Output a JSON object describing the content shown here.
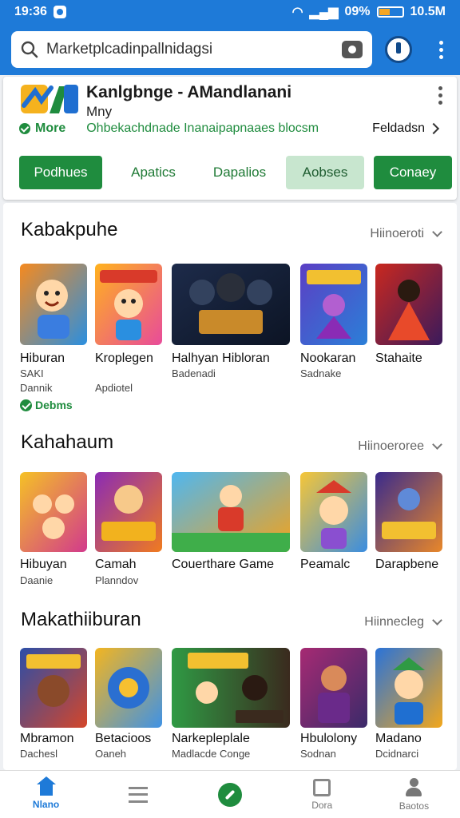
{
  "status_bar": {
    "time": "19:36",
    "battery_text": "09%",
    "clock_right": "10.5M",
    "battery_level": 0.45
  },
  "search": {
    "placeholder": "Marketplcadinpallnidagsi"
  },
  "app": {
    "title": "Kanlgbnge - AMandlanani",
    "subtitle": "Mny",
    "more_link": "More",
    "description": "Ohbekachdnade  Inanaipapnaaes blocsm",
    "description_link": "Feldadsn",
    "chips": [
      "Podhues",
      "Apatics",
      "Dapalios",
      "Aobses",
      "Conaey"
    ]
  },
  "sections": [
    {
      "title": "Kabakpuhe",
      "more": "Hiinoeroti",
      "items": [
        {
          "label": "Hiburan",
          "sub1": "SAKI",
          "sub2": "Dannik",
          "badge": "Debms",
          "colors": [
            "#f58a1f",
            "#2a8fe0"
          ]
        },
        {
          "label": "Kroplegen",
          "sub1": "Apdiotel",
          "colors": [
            "#ffb21e",
            "#e84b9a"
          ]
        },
        {
          "label": "Halhyan Hibloran",
          "sub1": "Badenadi",
          "colors": [
            "#1d2b4a",
            "#c98a2a"
          ]
        },
        {
          "label": "Nookaran",
          "sub1": "Sadnake",
          "colors": [
            "#5b3fc4",
            "#2b7fd8"
          ]
        },
        {
          "label": "Stahaite",
          "sub1": "",
          "colors": [
            "#c9281f",
            "#3a1a5c"
          ]
        }
      ]
    },
    {
      "title": "Kahahaum",
      "more": "Hiinoeroree",
      "items": [
        {
          "label": "Hibuyan",
          "sub1": "Daanie",
          "colors": [
            "#f5c126",
            "#d23a8c"
          ]
        },
        {
          "label": "Camah",
          "sub1": "Planndov",
          "colors": [
            "#8a2bb5",
            "#f07b1f"
          ]
        },
        {
          "label": "Couerthare Game",
          "sub1": "",
          "colors": [
            "#4fb7f0",
            "#f2a21c"
          ]
        },
        {
          "label": "Peamalc",
          "sub1": "",
          "colors": [
            "#f6c638",
            "#3a8de0"
          ]
        },
        {
          "label": "Darapbene",
          "sub1": "",
          "colors": [
            "#3a2b8c",
            "#e8872a"
          ]
        }
      ]
    },
    {
      "title": "Makathiiburan",
      "more": "Hiinnecleg",
      "items": [
        {
          "label": "Mbramon",
          "sub1": "Dachesl",
          "colors": [
            "#2b4ea8",
            "#d4462a"
          ]
        },
        {
          "label": "Betacioos",
          "sub1": "Oaneh",
          "colors": [
            "#f3b520",
            "#3f92e5"
          ]
        },
        {
          "label": "Narkepleplale",
          "sub1": "Madlacde Conge",
          "colors": [
            "#2f9a44",
            "#3a2a1e"
          ]
        },
        {
          "label": "Hbulolony",
          "sub1": "Sodnan",
          "colors": [
            "#a62a73",
            "#3b2a6a"
          ]
        },
        {
          "label": "Madano",
          "sub1": "Dcidnarci",
          "colors": [
            "#2a73d8",
            "#f2a71c"
          ]
        }
      ]
    }
  ],
  "nav": [
    {
      "label": "Nlano",
      "icon": "home-icon"
    },
    {
      "label": "",
      "icon": "list-icon"
    },
    {
      "label": "",
      "icon": "check-circle-icon"
    },
    {
      "label": "Dora",
      "icon": "box-icon"
    },
    {
      "label": "Baotos",
      "icon": "person-icon"
    }
  ]
}
